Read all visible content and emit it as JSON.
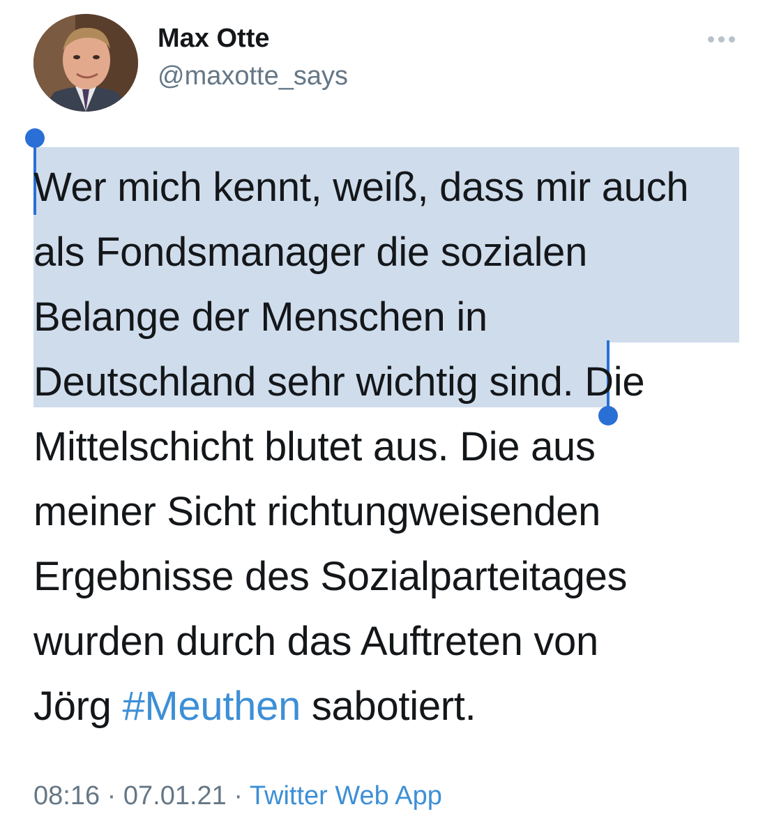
{
  "author": {
    "display_name": "Max Otte",
    "handle": "@maxotte_says"
  },
  "menu": {
    "icon": "more-horizontal-icon"
  },
  "tweet": {
    "lines": [
      "Wer mich kennt, weiß, dass mir auch",
      "als Fondsmanager die sozialen",
      "Belange der Menschen in",
      "Deutschland sehr wichtig sind",
      ". Die",
      "Mittelschicht blutet aus. Die aus",
      "meiner Sicht richtungweisenden",
      "Ergebnisse des Sozialparteitages",
      "wurden durch das Auftreten von",
      "Jörg ",
      "#Meuthen",
      " sabotiert."
    ],
    "selection_state": "text selected from start through \"sind\""
  },
  "meta": {
    "time": "08:16",
    "separator": " · ",
    "date": "07.01.21",
    "source": "Twitter Web App"
  },
  "colors": {
    "link": "#3d8fd6",
    "selection": "#cfdcec",
    "selection_handle": "#2a6fd6",
    "secondary_text": "#657786"
  }
}
